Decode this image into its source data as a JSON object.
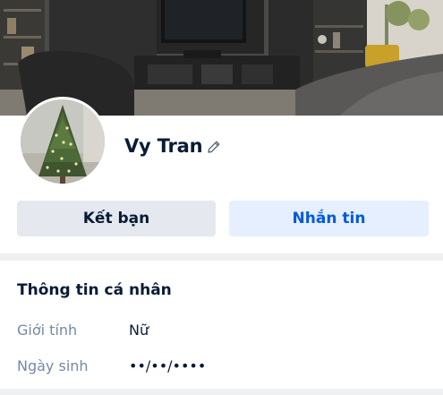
{
  "profile": {
    "cover_image": "living-room-cover-photo",
    "avatar_image": "christmas-tree-avatar",
    "name": "Vy Tran",
    "edit_icon": "pencil-icon"
  },
  "actions": {
    "add_friend_label": "Kết bạn",
    "message_label": "Nhắn tin"
  },
  "personal_info": {
    "title": "Thông tin cá nhân",
    "rows": [
      {
        "label": "Giới tính",
        "value": "Nữ"
      },
      {
        "label": "Ngày sinh",
        "value": "••/••/••••"
      }
    ]
  },
  "colors": {
    "primary_text": "#081c36",
    "secondary_text": "#7589a3",
    "accent": "#005ae0",
    "accent_bg": "#e5efff",
    "neutral_button_bg": "#e5e9ef",
    "divider": "#eef0f1"
  }
}
